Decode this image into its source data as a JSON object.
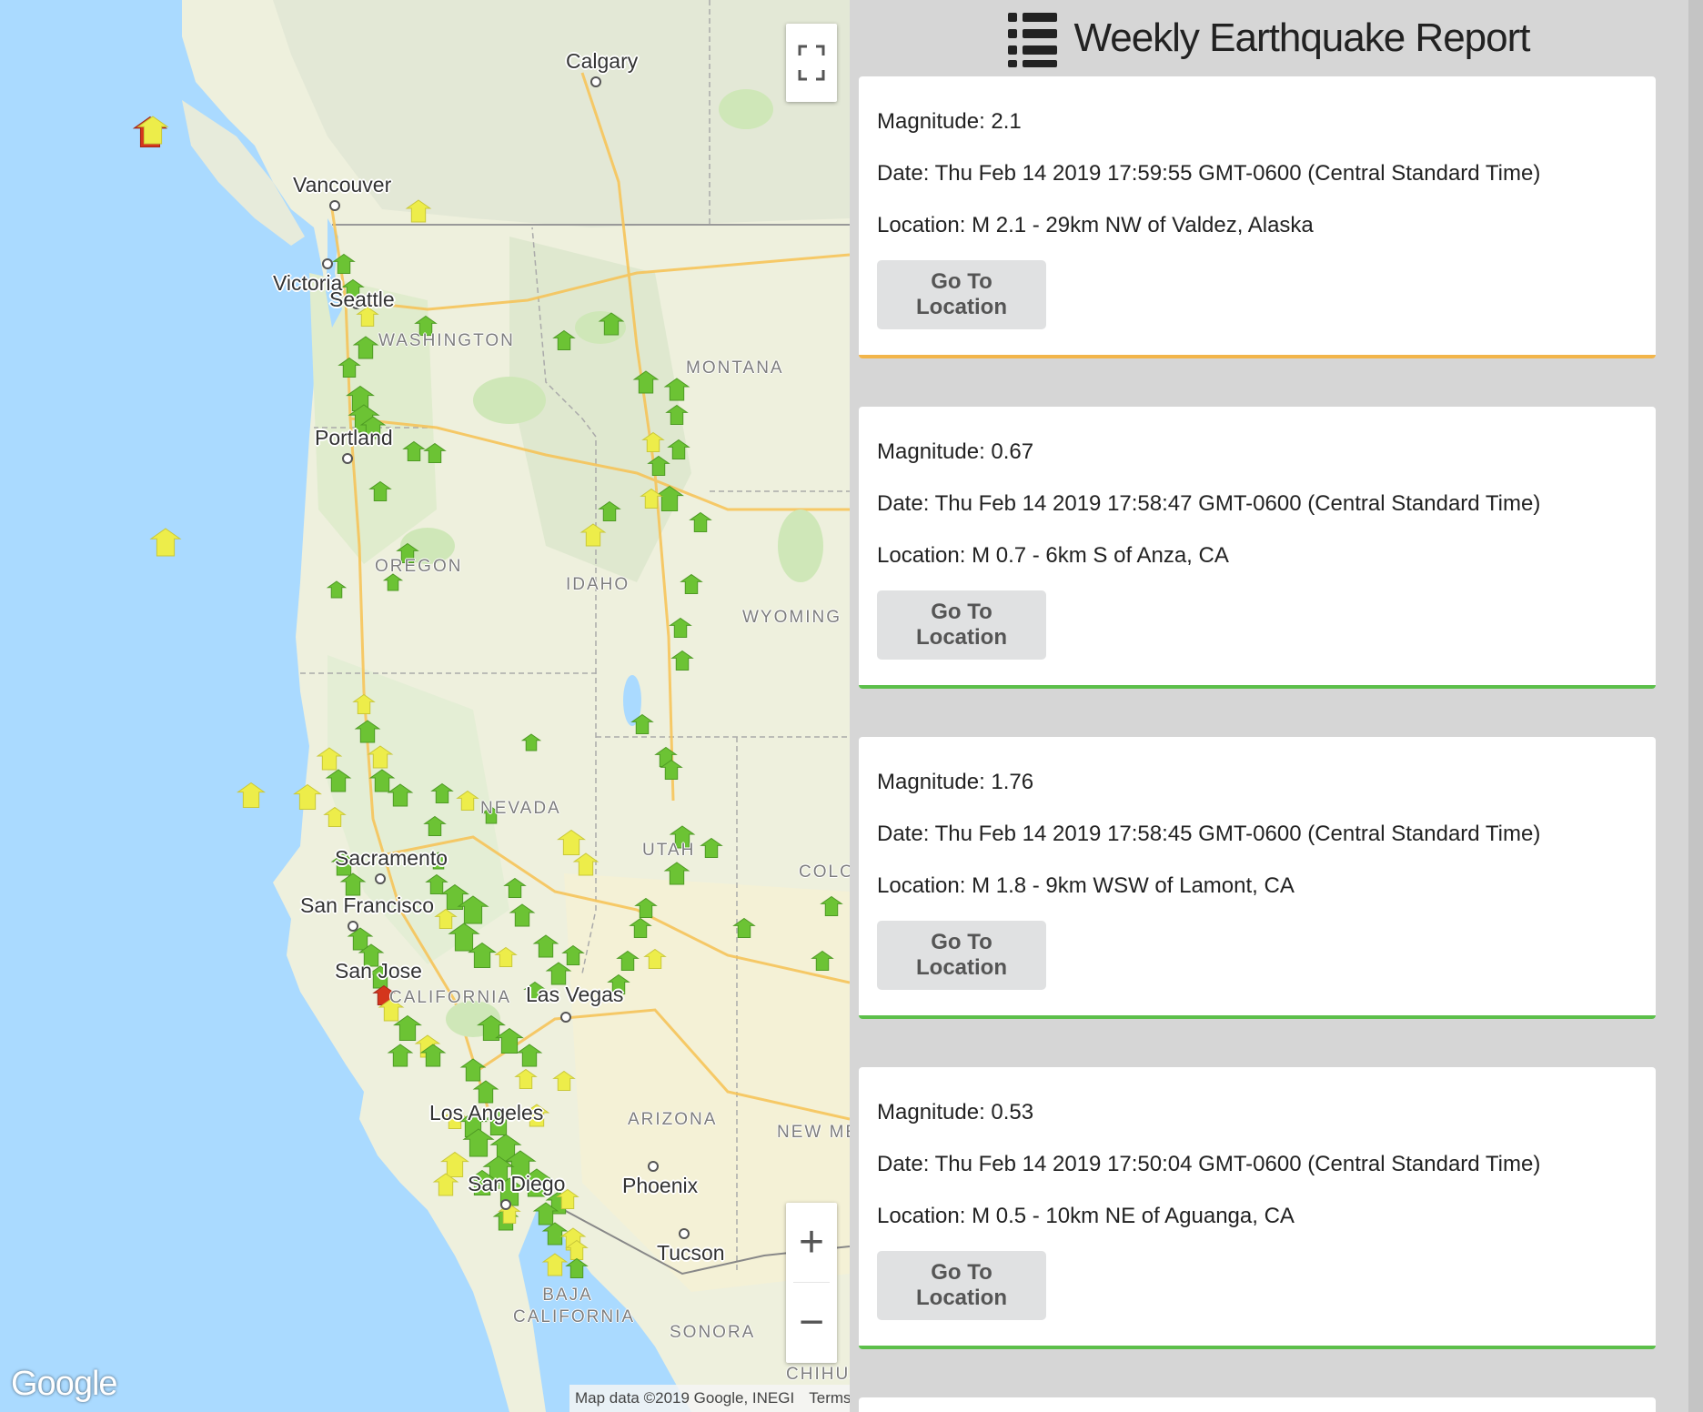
{
  "map": {
    "labels": {
      "calgary": "Calgary",
      "vancouver": "Vancouver",
      "victoria": "Victoria",
      "seattle": "Seattle",
      "portland": "Portland",
      "sacramento": "Sacramento",
      "san_francisco": "San Francisco",
      "san_jose": "San Jose",
      "las_vegas": "Las Vegas",
      "los_angeles": "Los Angeles",
      "san_diego": "San Diego",
      "phoenix": "Phoenix",
      "tucson": "Tucson",
      "washington": "WASHINGTON",
      "montana": "MONTANA",
      "oregon": "OREGON",
      "idaho": "IDAHO",
      "wyoming": "WYOMING",
      "nevada": "NEVADA",
      "utah": "UTAH",
      "colorado": "COLOR",
      "california": "CALIFORNIA",
      "arizona": "ARIZONA",
      "new_mexico": "NEW MEX",
      "baja_california": "BAJA CALIFORNIA",
      "sonora": "SONORA",
      "chihuahua": "CHIHUA"
    },
    "controls": {
      "fullscreen_icon": "fullscreen-icon",
      "zoom_in": "+",
      "zoom_out": "−"
    },
    "logo": "Google",
    "attribution": {
      "data": "Map data ©2019 Google, INEGI",
      "terms": "Terms of Use"
    },
    "marker_colors": {
      "green": "#6cc334",
      "yellow": "#eded4a",
      "red": "#d4351c"
    }
  },
  "sidebar": {
    "title": "Weekly Earthquake Report",
    "title_icon": "list-icon",
    "cards": [
      {
        "magnitude": "Magnitude: 2.1",
        "date": "Date: Thu Feb 14 2019 17:59:55 GMT-0600 (Central Standard Time)",
        "location": "Location: M 2.1 - 29km NW of Valdez, Alaska",
        "button": "Go To Location",
        "accent": "#f2b54a"
      },
      {
        "magnitude": "Magnitude: 0.67",
        "date": "Date: Thu Feb 14 2019 17:58:47 GMT-0600 (Central Standard Time)",
        "location": "Location: M 0.7 - 6km S of Anza, CA",
        "button": "Go To Location",
        "accent": "#5cbf4a"
      },
      {
        "magnitude": "Magnitude: 1.76",
        "date": "Date: Thu Feb 14 2019 17:58:45 GMT-0600 (Central Standard Time)",
        "location": "Location: M 1.8 - 9km WSW of Lamont, CA",
        "button": "Go To Location",
        "accent": "#5cbf4a"
      },
      {
        "magnitude": "Magnitude: 0.53",
        "date": "Date: Thu Feb 14 2019 17:50:04 GMT-0600 (Central Standard Time)",
        "location": "Location: M 0.5 - 10km NE of Aguanga, CA",
        "button": "Go To Location",
        "accent": "#5cbf4a"
      }
    ]
  }
}
